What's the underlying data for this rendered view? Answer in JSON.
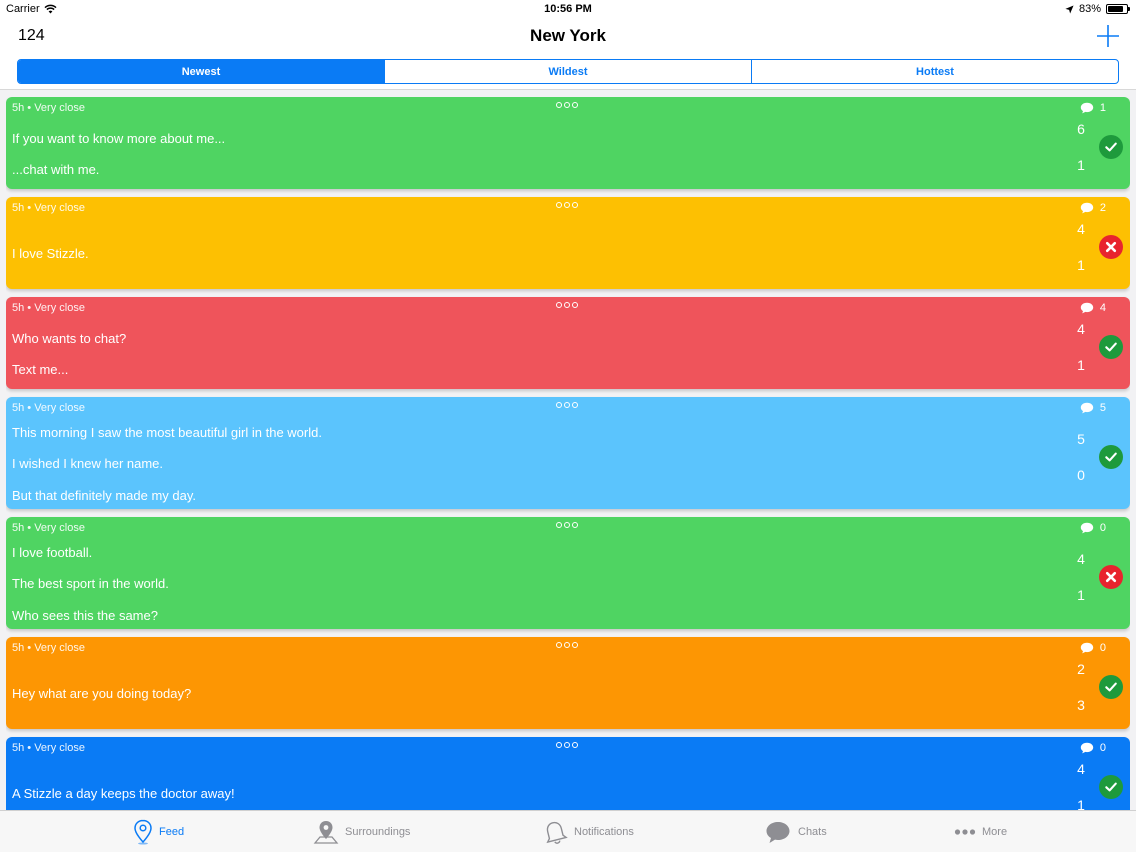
{
  "status": {
    "carrier": "Carrier",
    "time": "10:56 PM",
    "battery": "83%",
    "battery_level": 0.83
  },
  "nav": {
    "count": "124",
    "title": "New York"
  },
  "segments": [
    {
      "label": "Newest",
      "active": true
    },
    {
      "label": "Wildest",
      "active": false
    },
    {
      "label": "Hottest",
      "active": false
    }
  ],
  "colors": {
    "accent": "#0a7bf5",
    "approve_badge": "#1e9a3c",
    "reject_badge": "#e8242e"
  },
  "posts": [
    {
      "meta": "5h • Very close",
      "lines": [
        "If you want to know more about me...",
        "...chat with me."
      ],
      "comments": "1",
      "up": "6",
      "down": "1",
      "status": "approved",
      "color": "#4fd462"
    },
    {
      "meta": "5h • Very close",
      "lines": [
        "I love Stizzle."
      ],
      "comments": "2",
      "up": "4",
      "down": "1",
      "status": "rejected",
      "color": "#fdc002"
    },
    {
      "meta": "5h • Very close",
      "lines": [
        "Who wants to chat?",
        "Text me..."
      ],
      "comments": "4",
      "up": "4",
      "down": "1",
      "status": "approved",
      "color": "#ef545b"
    },
    {
      "meta": "5h • Very close",
      "lines": [
        "This morning I saw the most beautiful girl in the world.",
        "I wished I knew her name.",
        "But that definitely made my day."
      ],
      "comments": "5",
      "up": "5",
      "down": "0",
      "status": "approved",
      "color": "#5bc4fd"
    },
    {
      "meta": "5h • Very close",
      "lines": [
        "I love football.",
        "The best sport in the world.",
        "Who sees this the same?"
      ],
      "comments": "0",
      "up": "4",
      "down": "1",
      "status": "rejected",
      "color": "#4fd462"
    },
    {
      "meta": "5h • Very close",
      "lines": [
        "Hey what are you doing today?"
      ],
      "comments": "0",
      "up": "2",
      "down": "3",
      "status": "approved",
      "color": "#fd9603"
    },
    {
      "meta": "5h • Very close",
      "lines": [
        "A Stizzle a day keeps the doctor away!"
      ],
      "comments": "0",
      "up": "4",
      "down": "1",
      "status": "approved",
      "color": "#0a7bf5"
    }
  ],
  "tabs": [
    {
      "label": "Feed",
      "icon": "location-pin-icon",
      "active": true
    },
    {
      "label": "Surroundings",
      "icon": "map-pin-icon",
      "active": false
    },
    {
      "label": "Notifications",
      "icon": "bell-icon",
      "active": false
    },
    {
      "label": "Chats",
      "icon": "chat-bubble-icon",
      "active": false
    },
    {
      "label": "More",
      "icon": "more-dots-icon",
      "active": false
    }
  ]
}
